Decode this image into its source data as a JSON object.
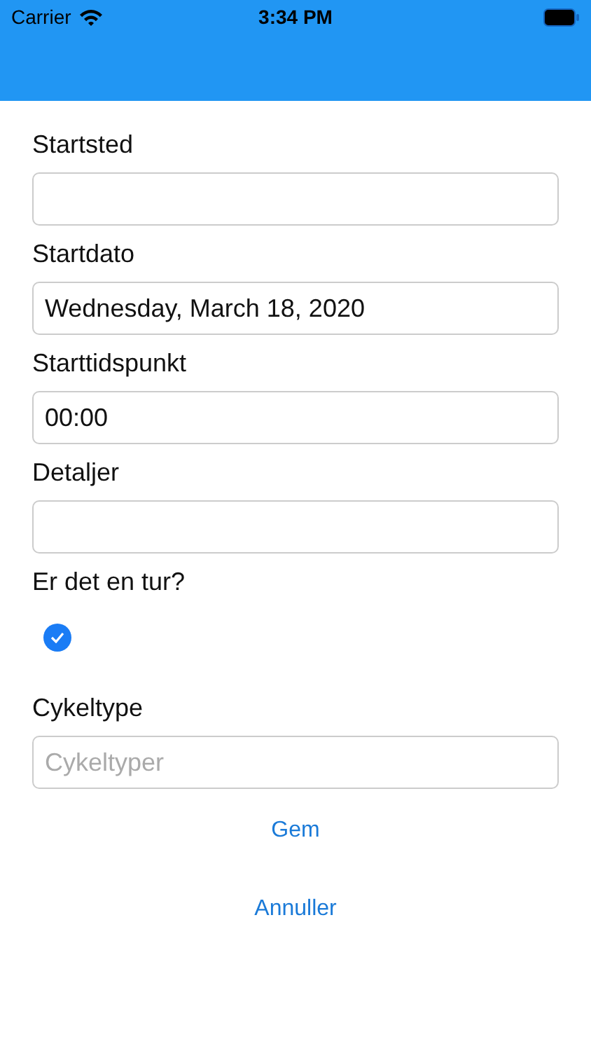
{
  "status_bar": {
    "carrier": "Carrier",
    "time": "3:34 PM"
  },
  "form": [
    {
      "kind": "text",
      "label": "Startsted"
    },
    {
      "kind": "text",
      "label": "Startdato",
      "value": "Wednesday, March 18, 2020"
    },
    {
      "kind": "text",
      "label": "Starttidspunkt",
      "value": "00:00"
    },
    {
      "kind": "text",
      "label": "Detaljer"
    },
    {
      "kind": "checkbox",
      "label": "Er det en tur?",
      "checked": true
    },
    {
      "kind": "text",
      "label": "Cykeltype",
      "placeholder": "Cykeltyper"
    }
  ],
  "buttons": [
    "Gem",
    "Annuller"
  ]
}
